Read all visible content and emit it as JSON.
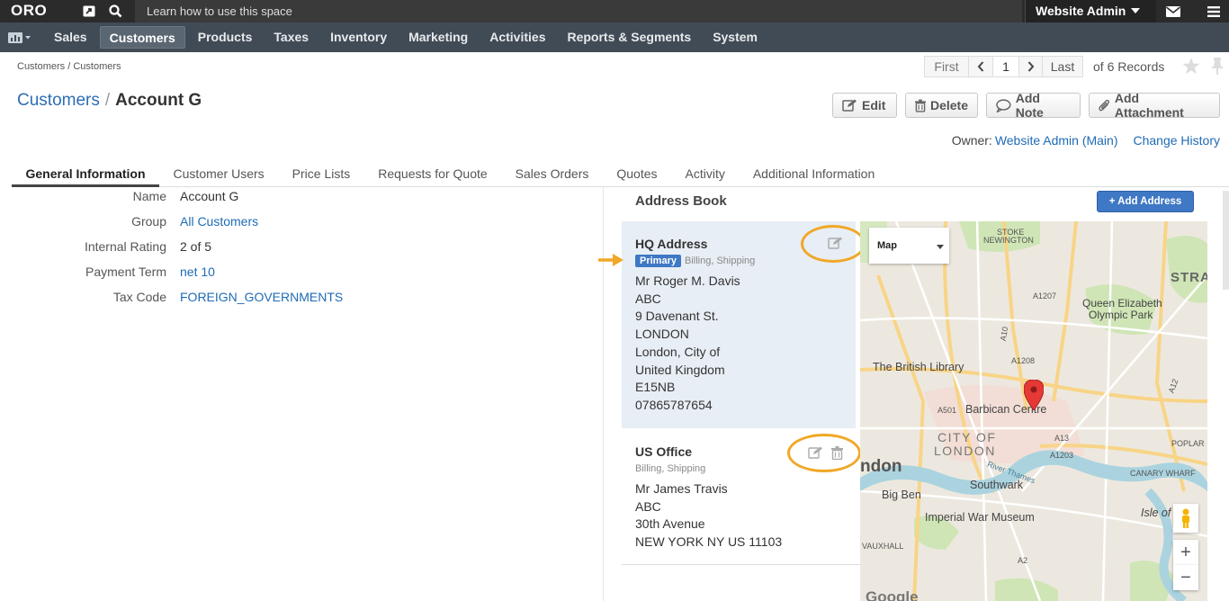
{
  "topbar": {
    "logo": "ORO",
    "learn_text": "Learn how to use this space",
    "user_name": "Website Admin"
  },
  "nav": {
    "items": [
      "Sales",
      "Customers",
      "Products",
      "Taxes",
      "Inventory",
      "Marketing",
      "Activities",
      "Reports & Segments",
      "System"
    ],
    "active": "Customers"
  },
  "breadcrumb": "Customers / Customers",
  "pager": {
    "first": "First",
    "page": "1",
    "last": "Last",
    "records": "of 6 Records"
  },
  "title": {
    "parent": "Customers",
    "separator": "/",
    "current": "Account G"
  },
  "actions": {
    "edit": "Edit",
    "delete": "Delete",
    "add_note": "Add Note",
    "add_attachment": "Add Attachment"
  },
  "owner": {
    "label": "Owner:",
    "value": "Website Admin (Main)",
    "change_history": "Change History"
  },
  "tabs": [
    "General Information",
    "Customer Users",
    "Price Lists",
    "Requests for Quote",
    "Sales Orders",
    "Quotes",
    "Activity",
    "Additional Information"
  ],
  "info": {
    "name_label": "Name",
    "name_value": "Account G",
    "group_label": "Group",
    "group_value": "All Customers",
    "rating_label": "Internal Rating",
    "rating_value": "2 of 5",
    "payment_label": "Payment Term",
    "payment_value": "net 10",
    "tax_label": "Tax Code",
    "tax_value": "FOREIGN_GOVERNMENTS"
  },
  "address_book": {
    "heading": "Address Book",
    "add_button": "+ Add Address",
    "hq": {
      "name": "HQ Address",
      "primary": "Primary",
      "types": "Billing, Shipping",
      "lines": [
        "Mr Roger M. Davis",
        "ABC",
        "9 Davenant St.",
        "LONDON",
        "London, City of",
        "United Kingdom",
        "E15NB",
        "07865787654"
      ]
    },
    "us": {
      "name": "US Office",
      "types": "Billing, Shipping",
      "lines": [
        "Mr James Travis",
        "ABC",
        "30th Avenue",
        "NEW YORK NY US 11103"
      ]
    }
  },
  "map": {
    "type_label": "Map",
    "labels": {
      "stoke": "STOKE",
      "newington": "NEWINGTON",
      "strat": "STRAT",
      "qe1": "Queen Elizabeth",
      "qe2": "Olympic Park",
      "british_library": "The British Library",
      "barbican": "Barbican Centre",
      "city1": "CITY OF",
      "city2": "LONDON",
      "london": "ndon",
      "big_ben": "Big Ben",
      "southwark": "Southwark",
      "iwm": "Imperial War Museum",
      "river": "River Thames",
      "poplar": "POPLAR",
      "canary": "CANARY WHARF",
      "isle": "Isle of",
      "vauxhall": "VAUXHALL",
      "a1203": "A1203",
      "a13": "A13",
      "a10": "A10",
      "a1207": "A1207",
      "a1208": "A1208",
      "a501": "A501",
      "a12": "A12",
      "a2": "A2",
      "google": "Google"
    },
    "zoom_in": "+",
    "zoom_out": "−"
  }
}
